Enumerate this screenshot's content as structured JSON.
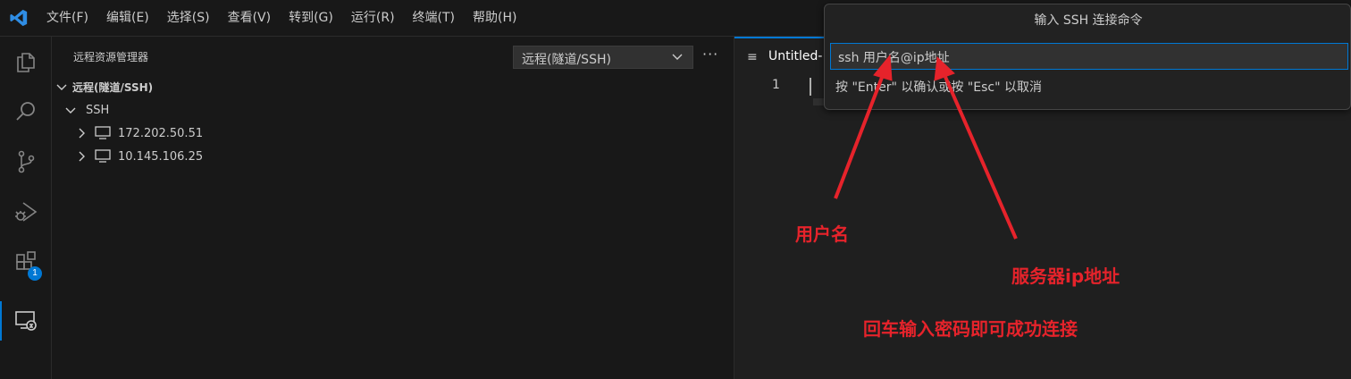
{
  "menu": {
    "items": [
      "文件(F)",
      "编辑(E)",
      "选择(S)",
      "查看(V)",
      "转到(G)",
      "运行(R)",
      "终端(T)",
      "帮助(H)"
    ]
  },
  "activity": {
    "icons": [
      "files-icon",
      "search-icon",
      "source-control-icon",
      "run-debug-icon",
      "extensions-icon",
      "remote-explorer-icon"
    ],
    "extensions_badge": "1"
  },
  "sidebar": {
    "title": "远程资源管理器",
    "remote_select": "远程(隧道/SSH)",
    "more": "···",
    "section": "远程(隧道/SSH)",
    "group": "SSH",
    "hosts": [
      "172.202.50.51",
      "10.145.106.25"
    ]
  },
  "editor": {
    "tab_label": "Untitled-",
    "tab_icon": "≡",
    "line_number": "1"
  },
  "quick_input": {
    "title": "输入 SSH 连接命令",
    "value": "ssh 用户名@ip地址",
    "hint": "按 \"Enter\" 以确认或按 \"Esc\" 以取消"
  },
  "annotations": {
    "username": "用户名",
    "server_ip": "服务器ip地址",
    "enter_password": "回车输入密码即可成功连接",
    "color": "#e6232b"
  },
  "colors": {
    "accent": "#0078d4",
    "background": "#1f1f1f",
    "sidebar": "#181818"
  }
}
